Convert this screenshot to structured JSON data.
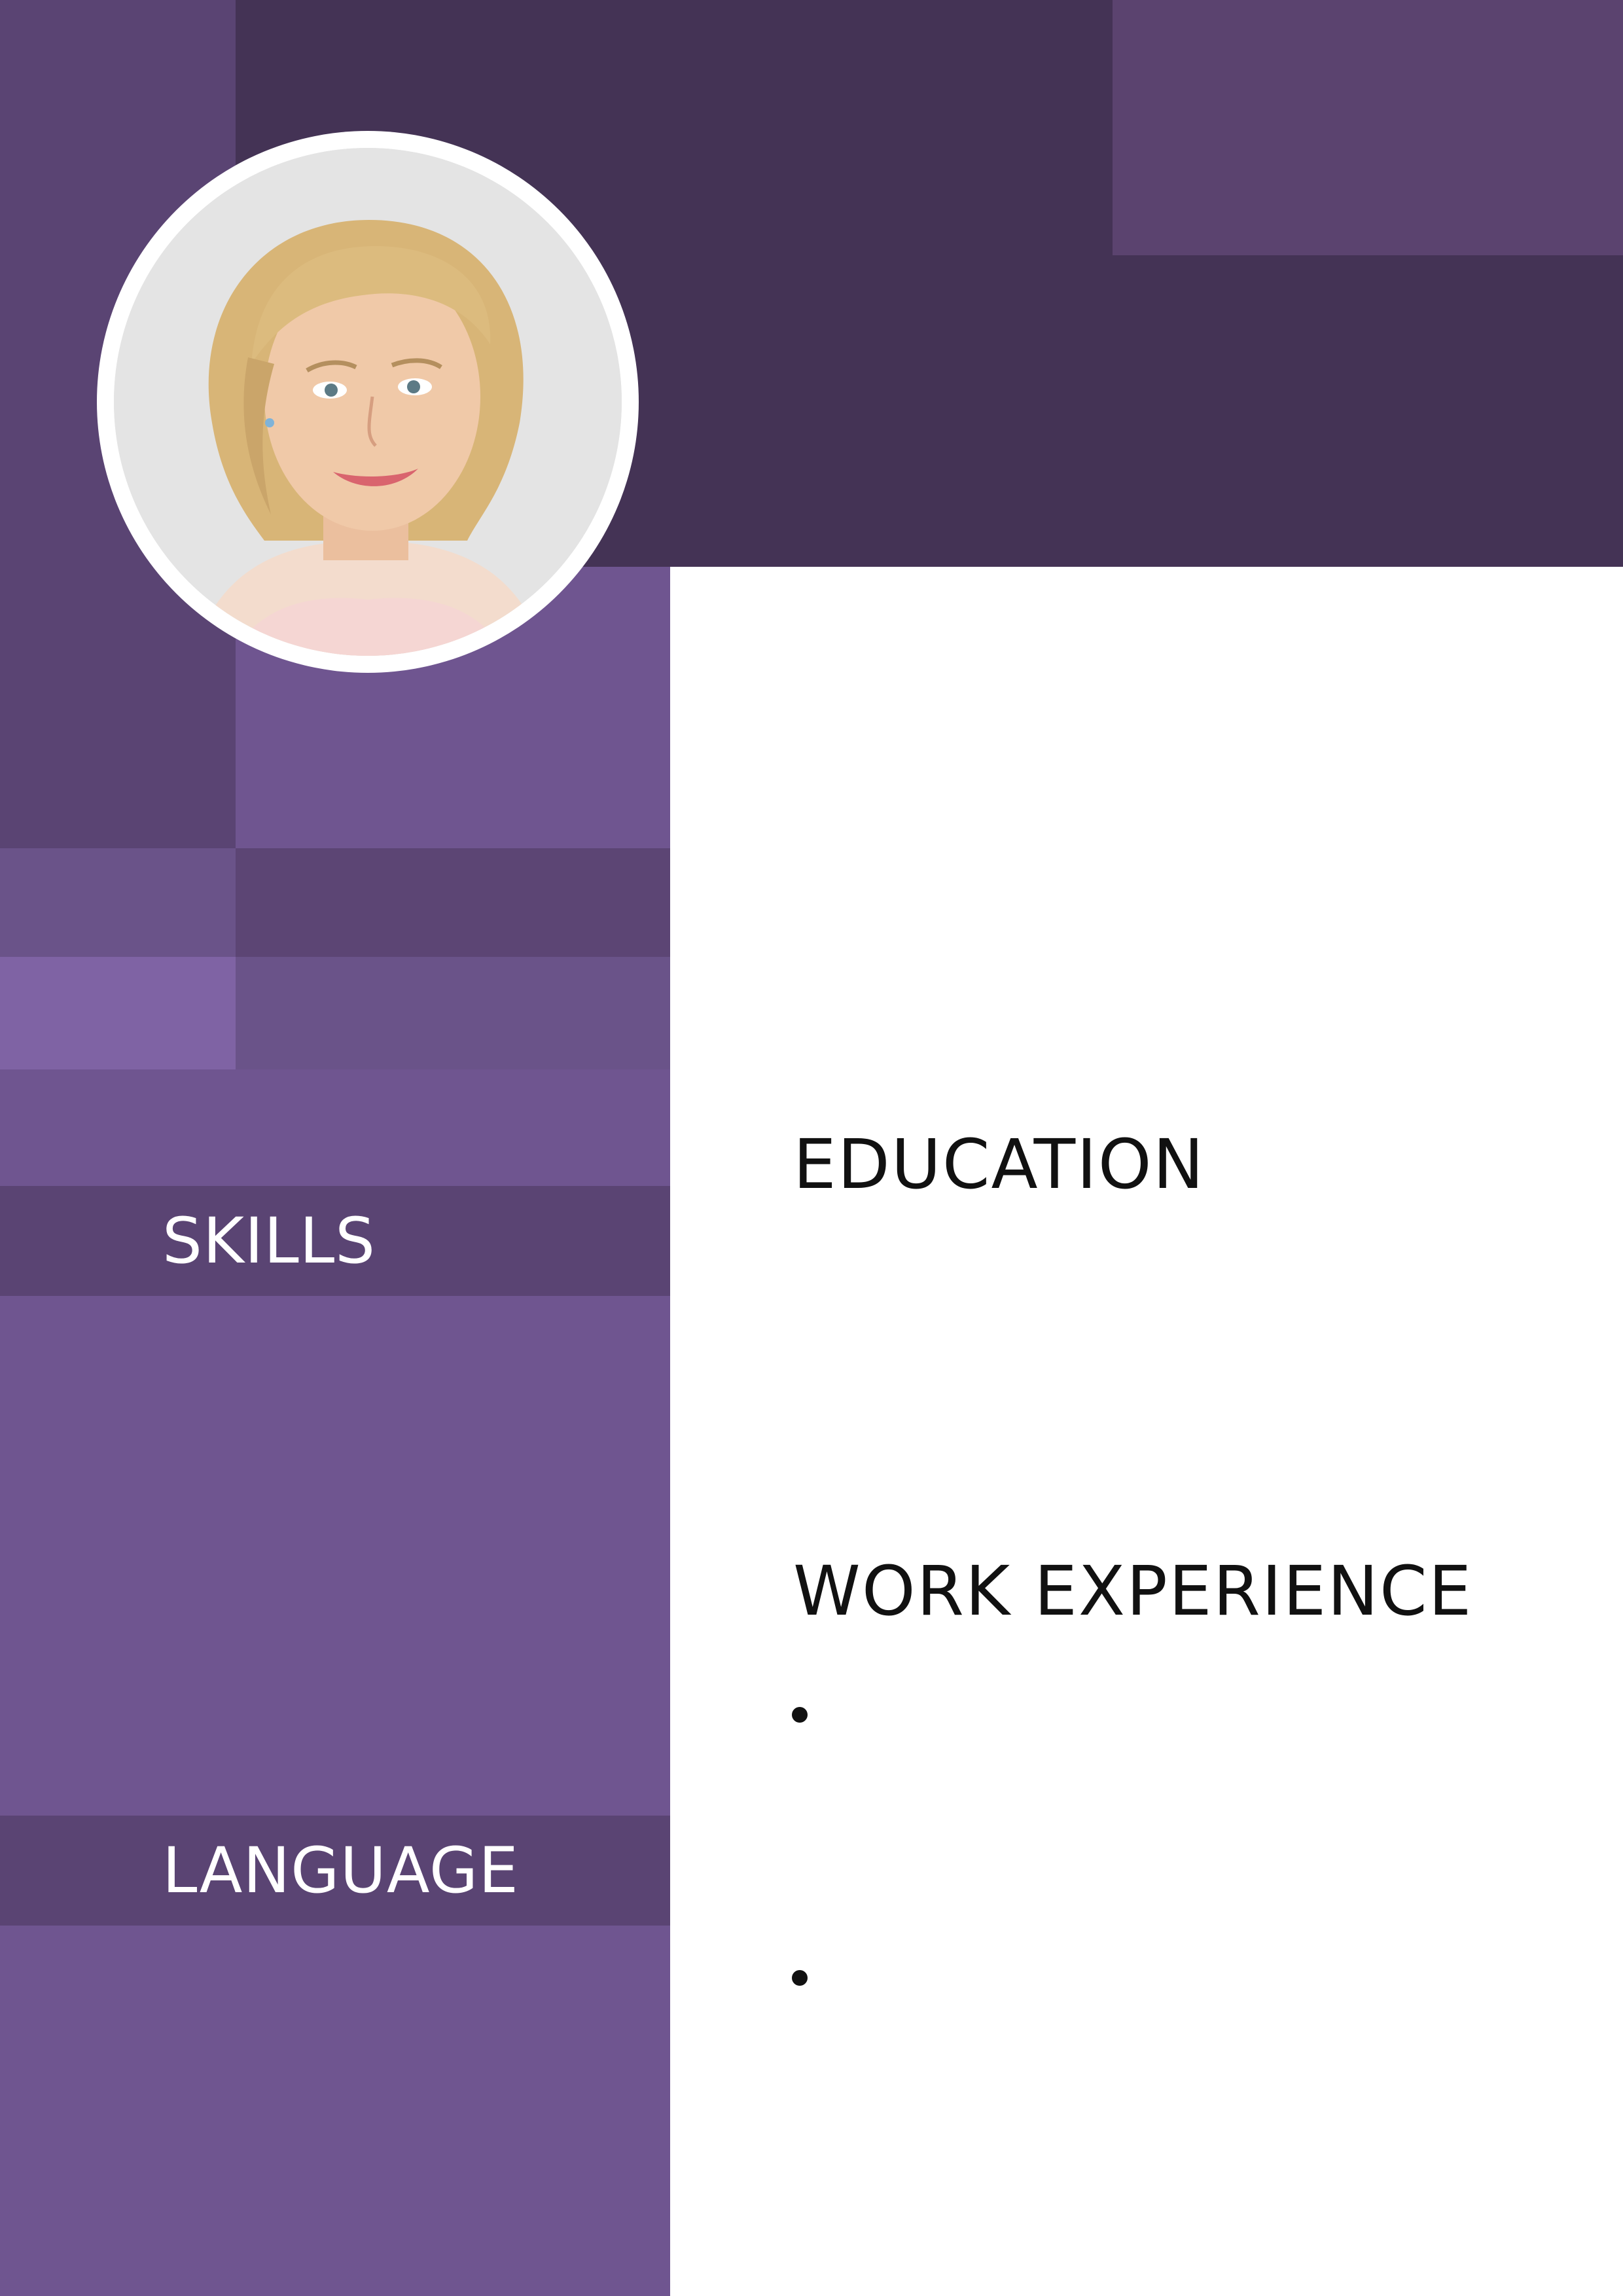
{
  "sidebar": {
    "skills_label": "SKILLS",
    "language_label": "LANGUAGE"
  },
  "main": {
    "education_heading": "EDUCATION",
    "work_heading": "WORK EXPERIENCE",
    "work_items": [
      "",
      ""
    ]
  },
  "colors": {
    "dark_purple": "#443355",
    "mid_purple": "#5a4473",
    "light_purple": "#6f5590",
    "accent_purple": "#7f63a4",
    "card_background": "#ffffff",
    "heading_text": "#111111"
  },
  "photo": {
    "icon": "profile-photo"
  }
}
